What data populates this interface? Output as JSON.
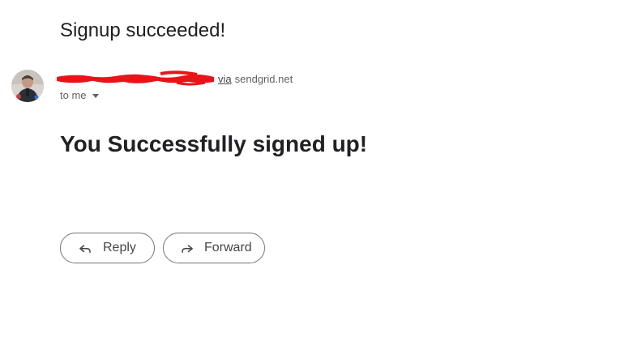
{
  "email": {
    "subject": "Signup succeeded!",
    "sender": {
      "name_redacted": true,
      "via_label": "via",
      "via_domain": "sendgrid.net"
    },
    "recipient_label": "to me",
    "body_heading": "You Successfully signed up!"
  },
  "actions": {
    "reply_label": "Reply",
    "forward_label": "Forward"
  },
  "colors": {
    "redaction": "#e8141a",
    "text_primary": "#202124",
    "text_secondary": "#5f6368",
    "button_border": "#747775"
  },
  "icons": {
    "avatar": "sender-avatar",
    "recipient_caret": "caret-down-icon",
    "reply": "reply-icon",
    "forward": "forward-icon"
  }
}
